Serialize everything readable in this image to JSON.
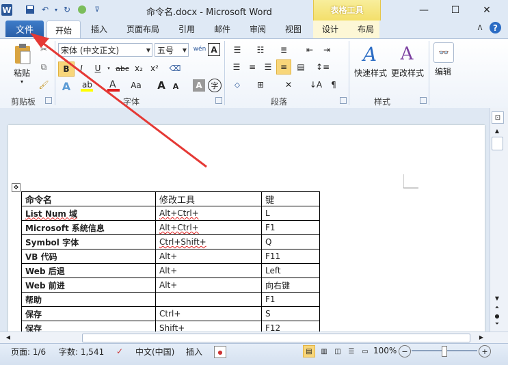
{
  "window": {
    "title": "命令名.docx - Microsoft Word",
    "app_icon": "W",
    "context_group": "表格工具",
    "controls": {
      "minimize": "—",
      "maximize": "☐",
      "close": "✕"
    }
  },
  "tabs": {
    "file": "文件",
    "home": "开始",
    "insert": "插入",
    "layout": "页面布局",
    "references": "引用",
    "mailings": "邮件",
    "review": "审阅",
    "view": "视图",
    "design": "设计",
    "table_layout": "布局"
  },
  "ribbon": {
    "clipboard": {
      "label": "剪贴板",
      "paste": "粘贴"
    },
    "font": {
      "label": "字体",
      "font_name": "宋体 (中文正文)",
      "font_size": "五号",
      "bold": "B",
      "italic": "I",
      "underline": "U",
      "strike": "abc",
      "sub": "x₂",
      "sup": "x²",
      "grow": "A",
      "shrink": "A",
      "clear": "Aa",
      "phonetic": "wén",
      "border_char": "A",
      "shade_char": "A",
      "circle_char": "字"
    },
    "paragraph": {
      "label": "段落"
    },
    "styles": {
      "label": "样式",
      "quick_styles": "快速样式",
      "change_styles": "更改样式"
    },
    "editing": {
      "label": "编辑"
    }
  },
  "table": {
    "header": [
      "命令名",
      "修改工具",
      "键"
    ],
    "rows": [
      [
        "List Num 域",
        "Alt+Ctrl+",
        "L"
      ],
      [
        "Microsoft 系统信息",
        "Alt+Ctrl+",
        "F1"
      ],
      [
        "Symbol 字体",
        "Ctrl+Shift+",
        "Q"
      ],
      [
        "VB 代码",
        "Alt+",
        "F11"
      ],
      [
        "Web 后退",
        "Alt+",
        "Left"
      ],
      [
        "Web 前进",
        "Alt+",
        "向右键"
      ],
      [
        "帮助",
        "",
        "F1"
      ],
      [
        "保存",
        "Ctrl+",
        "S"
      ],
      [
        "保存",
        "Shift+",
        "F12"
      ]
    ]
  },
  "status": {
    "page": "页面: 1/6",
    "words": "字数: 1,541",
    "language": "中文(中国)",
    "mode": "插入",
    "zoom": "100%"
  },
  "colors": {
    "accent": "#2b579a",
    "annotation_arrow": "#e53935",
    "context_tab": "#f3df6a"
  }
}
